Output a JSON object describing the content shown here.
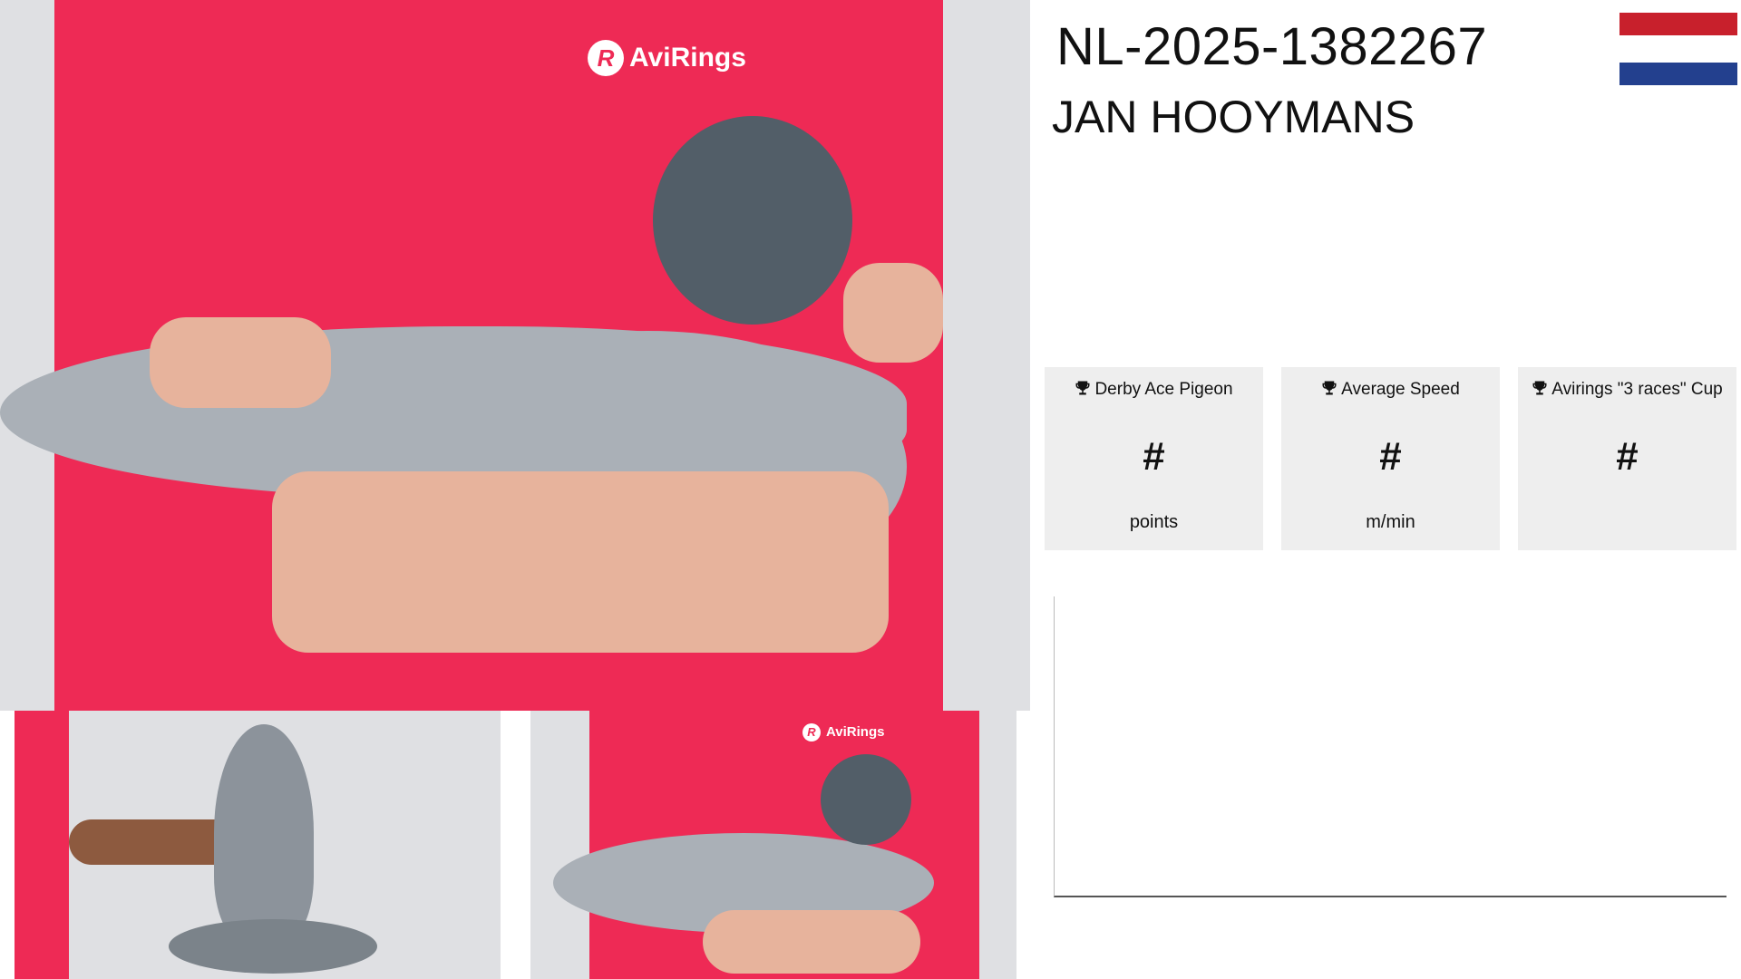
{
  "header": {
    "ring_number": "NL-2025-1382267",
    "owner_name": "JAN HOOYMANS"
  },
  "flag": {
    "country": "NL",
    "colors": [
      "#c8202c",
      "#ffffff",
      "#23408e"
    ]
  },
  "photos": {
    "brand_text": "AviRings"
  },
  "stats": [
    {
      "icon": "trophy-icon",
      "title": "Derby Ace Pigeon",
      "value": "#",
      "unit": "points"
    },
    {
      "icon": "trophy-icon",
      "title": "Average Speed",
      "value": "#",
      "unit": "m/min"
    },
    {
      "icon": "trophy-icon",
      "title": "Avirings \"3 races\" Cup",
      "value": "#",
      "unit": ""
    }
  ]
}
